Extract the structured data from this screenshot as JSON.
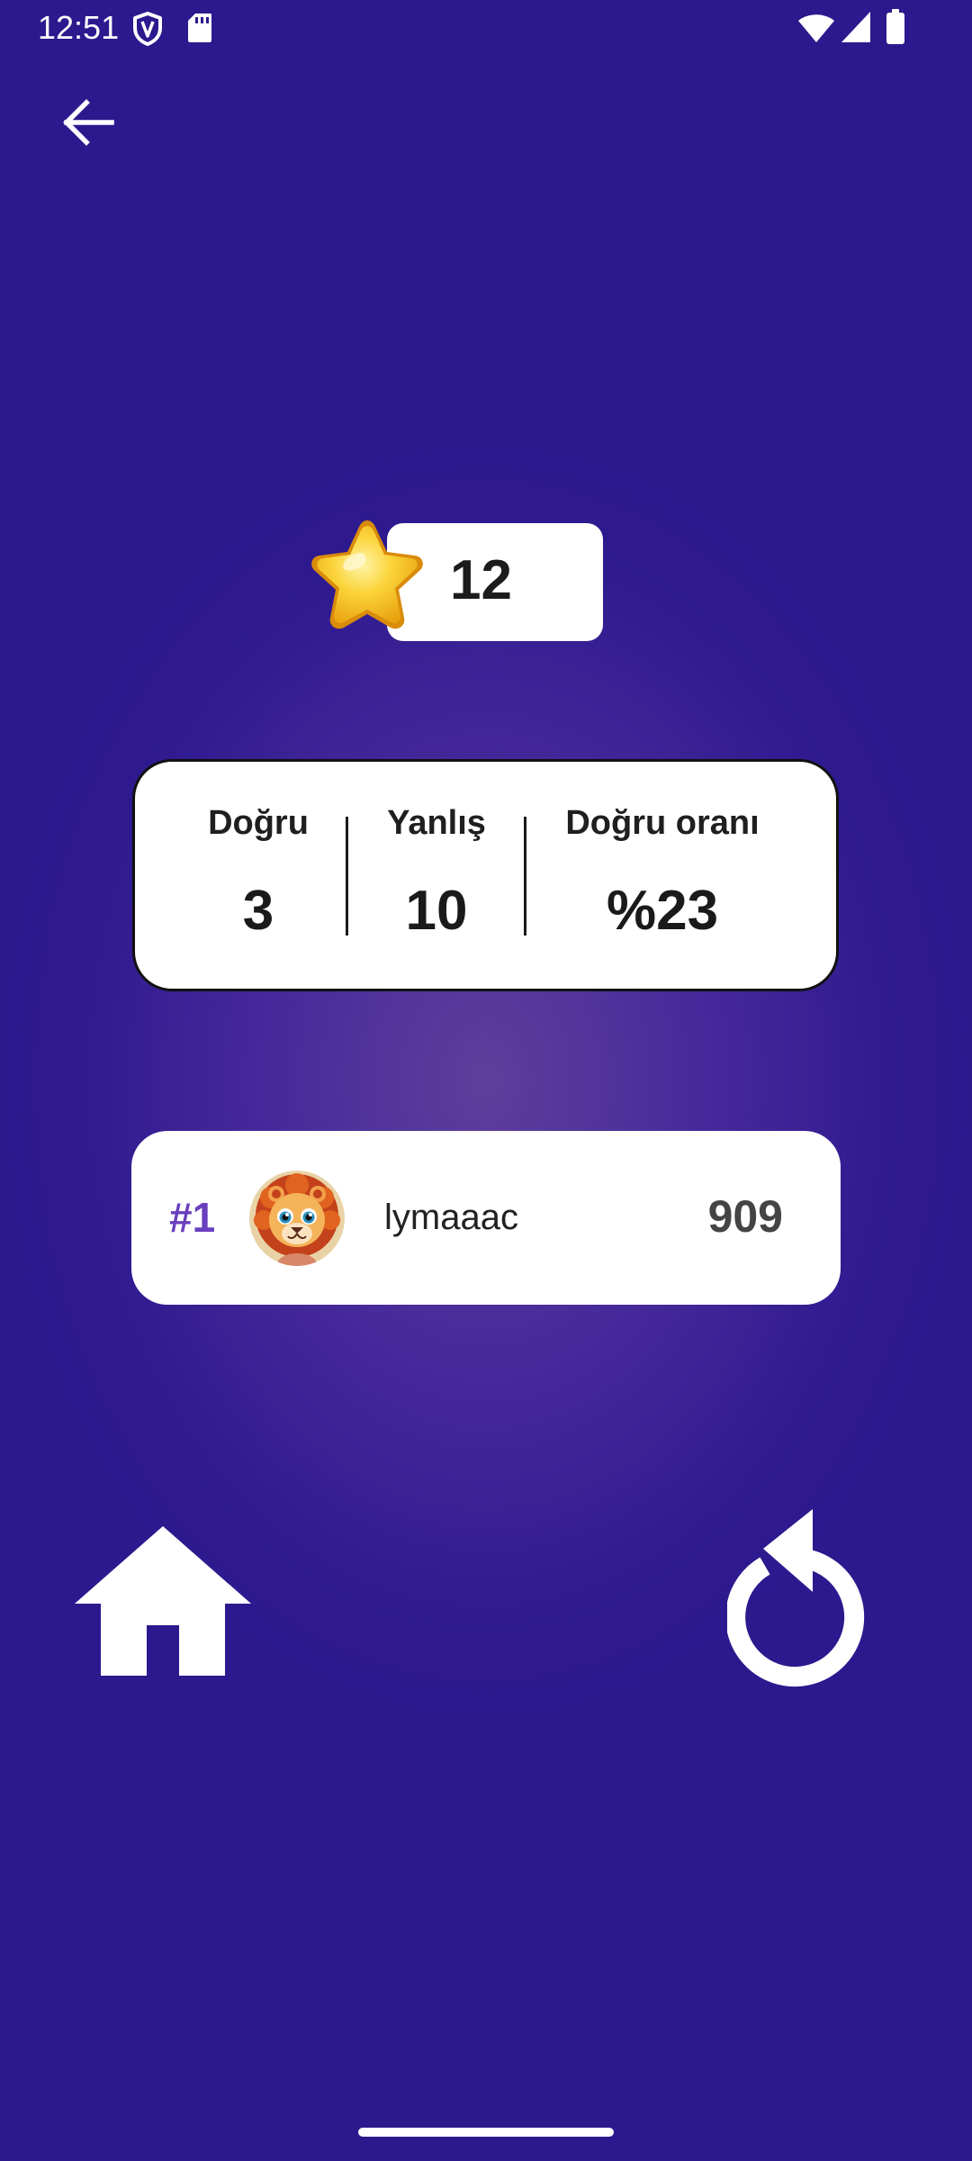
{
  "status_bar": {
    "time": "12:51",
    "icons": [
      "shield-icon",
      "sd-card-icon",
      "wifi-icon",
      "signal-icon",
      "battery-icon"
    ]
  },
  "header": {
    "back_icon": "arrow-left-icon"
  },
  "score": {
    "icon": "star-icon",
    "value": "12"
  },
  "stats": {
    "correct_label": "Doğru",
    "correct_value": "3",
    "wrong_label": "Yanlış",
    "wrong_value": "10",
    "ratio_label": "Doğru oranı",
    "ratio_value": "%23"
  },
  "leaderboard": {
    "rank": "#1",
    "avatar": "lion-avatar",
    "username": "lymaaac",
    "points": "909"
  },
  "actions": {
    "home_icon": "home-icon",
    "replay_icon": "replay-icon"
  },
  "colors": {
    "background": "#2c198e",
    "background_glow": "#5e3f9c",
    "rank_accent": "#6a3fbf",
    "star_gold": "#f6c21c"
  }
}
